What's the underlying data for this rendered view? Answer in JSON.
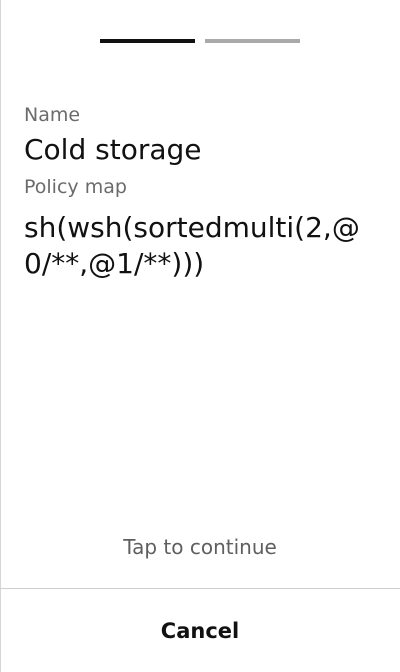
{
  "pager": {
    "total": 2,
    "current": 1
  },
  "details": {
    "name_label": "Name",
    "name_value": "Cold storage",
    "policy_label": "Policy map",
    "policy_value": "sh(wsh(sortedmulti(2,@0/**,@1/**)))"
  },
  "footer": {
    "hint": "Tap to continue",
    "cancel_label": "Cancel"
  }
}
